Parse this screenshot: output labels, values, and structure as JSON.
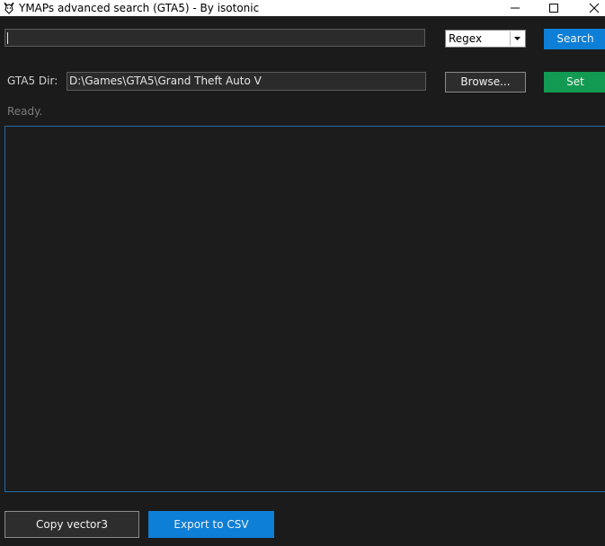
{
  "window": {
    "title": "YMAPs advanced search (GTA5) - By isotonic",
    "icon": "gta-app-icon"
  },
  "search": {
    "value": "",
    "mode_selected": "Regex",
    "button_label": "Search"
  },
  "gta_dir": {
    "label": "GTA5 Dir:",
    "value": "D:\\Games\\GTA5\\Grand Theft Auto V",
    "browse_label": "Browse...",
    "set_label": "Set"
  },
  "status": "Ready.",
  "footer": {
    "copy_label": "Copy vector3",
    "export_label": "Export to CSV"
  },
  "colors": {
    "background": "#1b1b1b",
    "accent_blue": "#0e7fd6",
    "accent_green": "#129a52",
    "results_border": "#1f6aa8"
  }
}
